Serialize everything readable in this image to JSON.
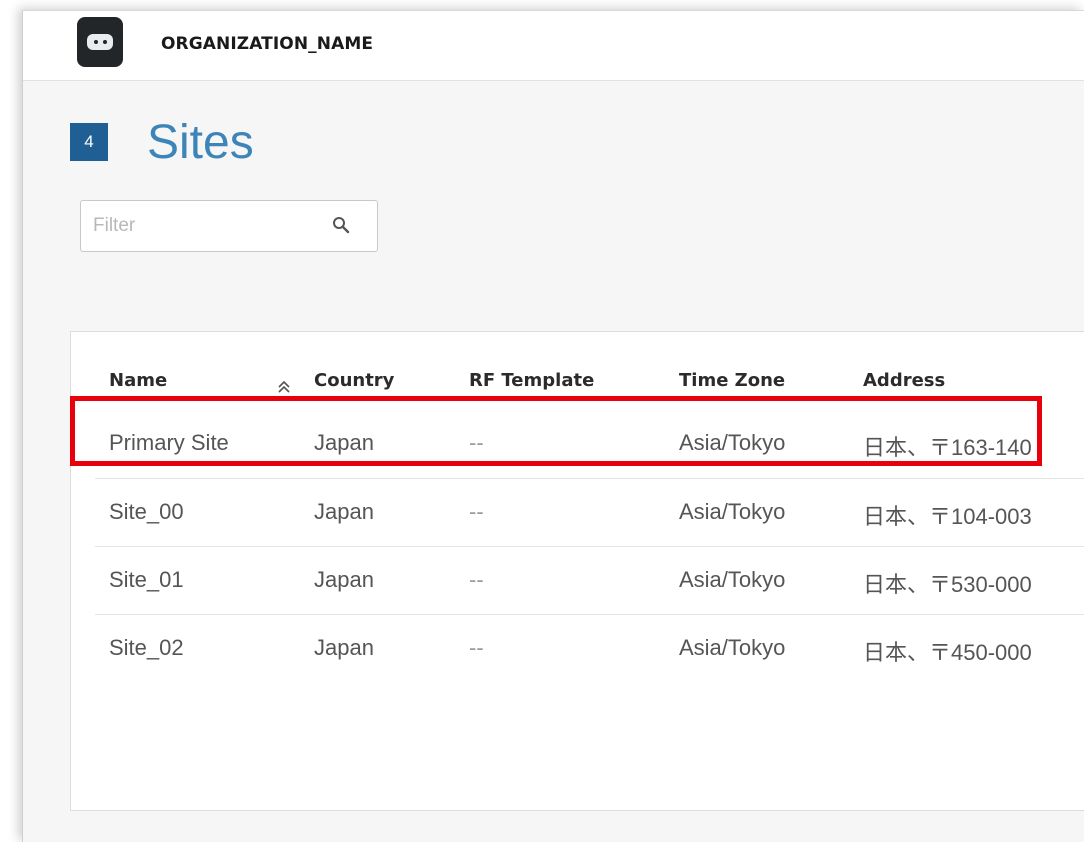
{
  "header": {
    "org_name": "ORGANIZATION_NAME",
    "logo_icon": "robot-logo-icon"
  },
  "page": {
    "count": "4",
    "title": "Sites"
  },
  "filter": {
    "placeholder": "Filter",
    "value": "",
    "icon": "search-icon"
  },
  "table": {
    "columns": [
      "Name",
      "Country",
      "RF Template",
      "Time Zone",
      "Address"
    ],
    "sort": {
      "column": "Name",
      "icon": "sort-ascending-icon"
    },
    "rows": [
      {
        "name": "Primary Site",
        "country": "Japan",
        "rf_template": "--",
        "time_zone": "Asia/Tokyo",
        "address": "日本、〒163-140"
      },
      {
        "name": "Site_00",
        "country": "Japan",
        "rf_template": "--",
        "time_zone": "Asia/Tokyo",
        "address": "日本、〒104-003"
      },
      {
        "name": "Site_01",
        "country": "Japan",
        "rf_template": "--",
        "time_zone": "Asia/Tokyo",
        "address": "日本、〒530-000"
      },
      {
        "name": "Site_02",
        "country": "Japan",
        "rf_template": "--",
        "time_zone": "Asia/Tokyo",
        "address": "日本、〒450-000"
      }
    ]
  },
  "colors": {
    "accent": "#3d84b8",
    "badge": "#1f5f93",
    "highlight": "#e8000b"
  }
}
